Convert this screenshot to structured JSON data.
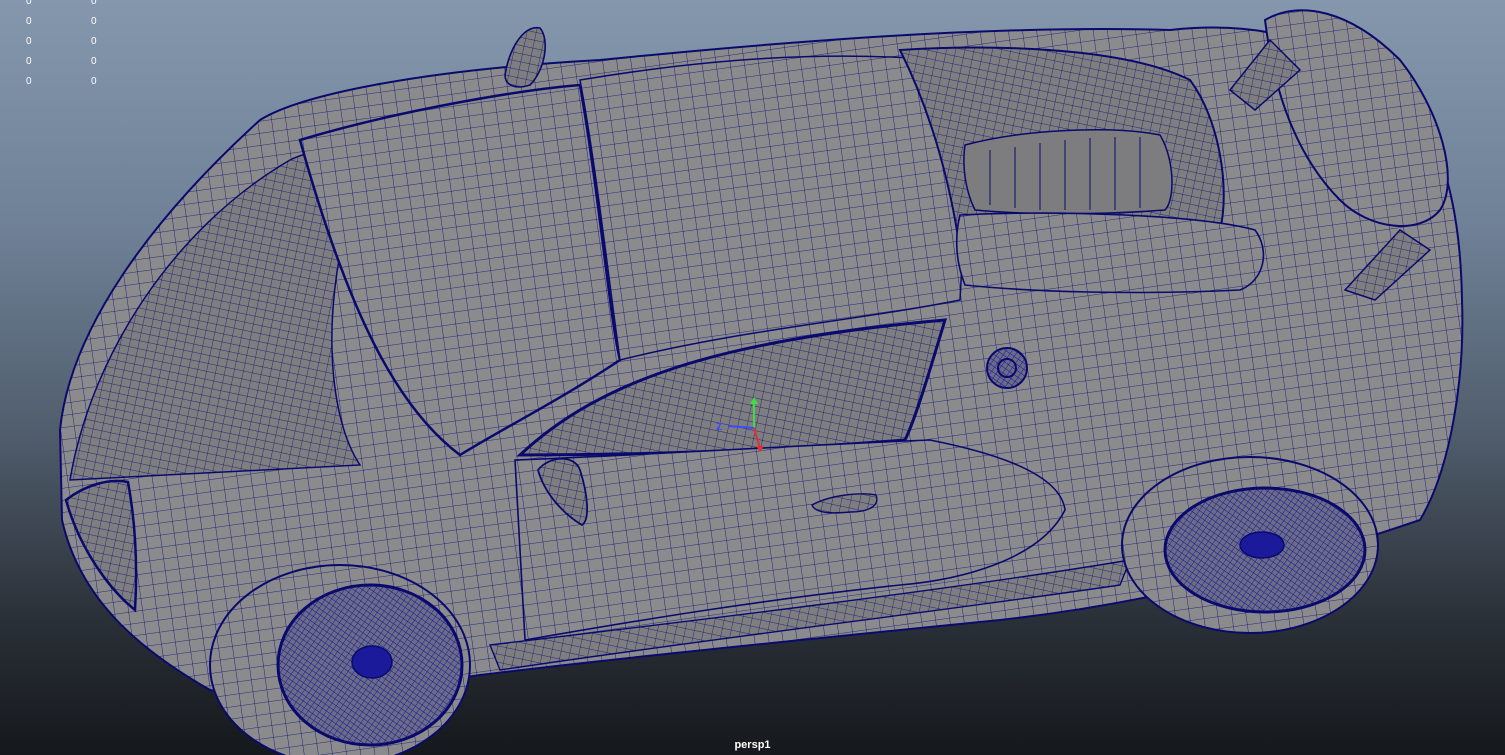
{
  "viewport": {
    "camera_name": "persp1",
    "background_top": "#8497ad",
    "background_bottom": "#15181c"
  },
  "heads_up_display": {
    "rows": [
      [
        "0",
        "0"
      ],
      [
        "0",
        "0"
      ],
      [
        "0",
        "0"
      ],
      [
        "0",
        "0"
      ],
      [
        "0",
        "0"
      ]
    ]
  },
  "axis_gizmo": {
    "z_label": "Z",
    "y_color": "#3fdc3f",
    "x_color": "#e03030",
    "z_color": "#3a4cff"
  },
  "mesh": {
    "surface_color": "#8b8b8d",
    "wire_color": "#0a0a6e",
    "object": "sports car wireframe"
  }
}
